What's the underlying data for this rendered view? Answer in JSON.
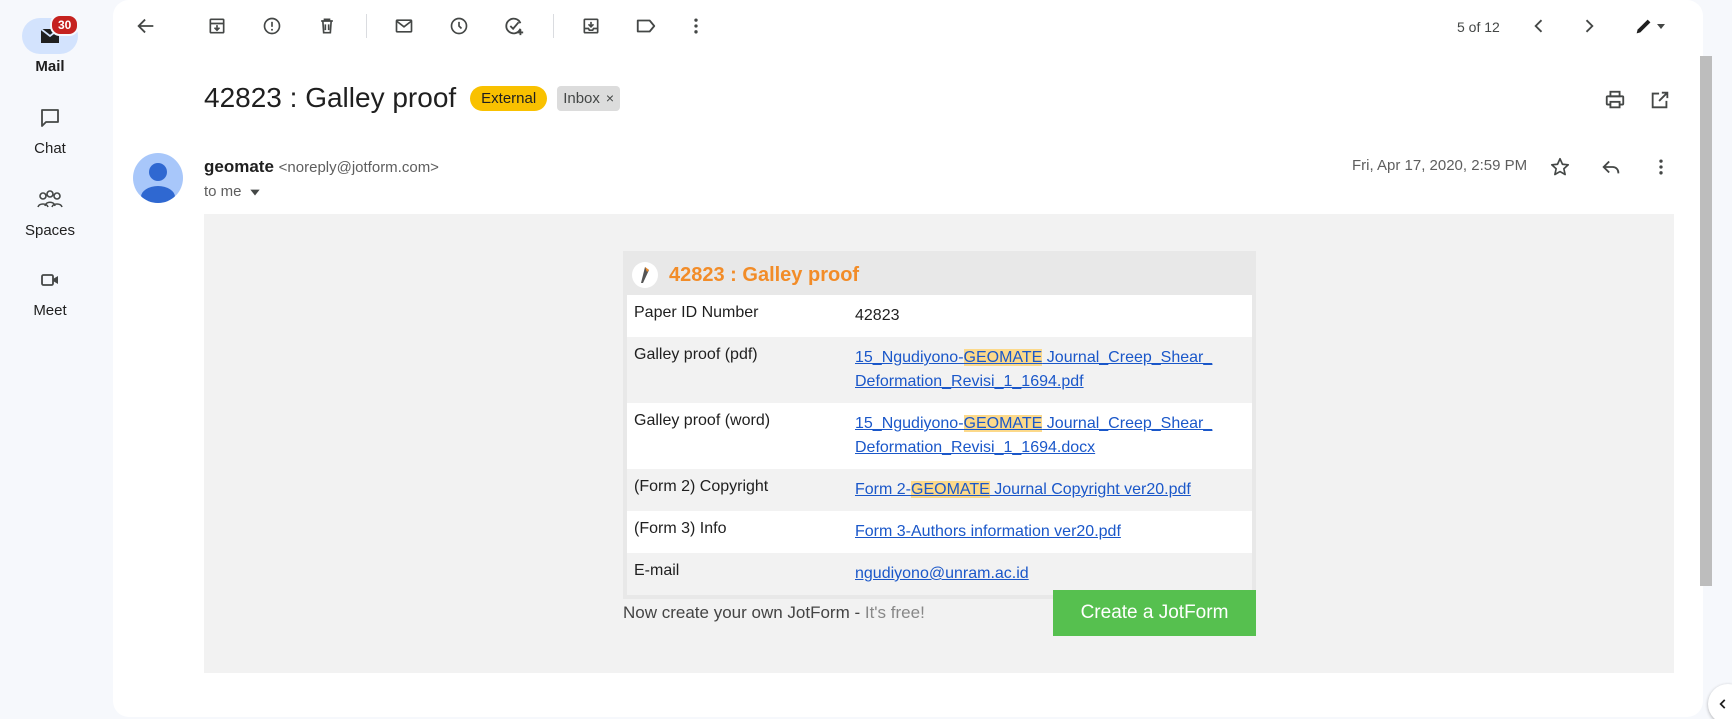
{
  "rail": {
    "mail": {
      "label": "Mail",
      "badge": "30"
    },
    "chat": {
      "label": "Chat"
    },
    "spaces": {
      "label": "Spaces"
    },
    "meet": {
      "label": "Meet"
    }
  },
  "toolbar": {
    "page_count": "5 of 12",
    "icons": [
      "back-arrow-icon",
      "archive-icon",
      "report-spam-icon",
      "delete-icon",
      "mark-unread-icon",
      "snooze-icon",
      "add-task-icon",
      "move-to-icon",
      "label-icon",
      "more-vert-icon",
      "older-icon",
      "newer-icon",
      "edit-icon"
    ]
  },
  "message": {
    "subject": "42823 : Galley proof",
    "chip_external": "External",
    "chip_inbox": "Inbox",
    "chip_inbox_close": "×",
    "sender_name": "geomate",
    "sender_email": "<noreply@jotform.com>",
    "to": "to me",
    "date": "Fri, Apr 17, 2020, 2:59 PM"
  },
  "form": {
    "title": "42823 : Galley proof",
    "rows": [
      {
        "key": "Paper ID Number",
        "value": "42823"
      },
      {
        "key": "Galley proof (pdf)",
        "link_pre": "15_Ngudiyono-",
        "link_hl": "GEOMATE",
        "link_post": " Journal_Creep_Shear_",
        "link_line2": "Deformation_Revisi_1_1694.pdf"
      },
      {
        "key": "Galley proof (word)",
        "link_pre": "15_Ngudiyono-",
        "link_hl": "GEOMATE",
        "link_post": " Journal_Creep_Shear_",
        "link_line2": "Deformation_Revisi_1_1694.docx"
      },
      {
        "key": "(Form 2) Copyright",
        "link_pre": "Form 2-",
        "link_hl": "GEOMATE",
        "link_post": " Journal Copyright ver20.pdf"
      },
      {
        "key": "(Form 3) Info",
        "link": "Form 3-Authors information ver20.pdf"
      },
      {
        "key": "E-mail",
        "link": "ngudiyono@unram.ac.id"
      }
    ]
  },
  "promo": {
    "text": "Now create your own JotForm - ",
    "free": "It's free!",
    "cta": "Create a JotForm"
  },
  "colors": {
    "rail_active": "#d3e3fd",
    "badge": "#c5221f",
    "external_chip": "#f9c100",
    "form_title": "#f28c28",
    "link": "#1a57c9",
    "highlight": "#fcd98a",
    "cta": "#56c04f"
  }
}
